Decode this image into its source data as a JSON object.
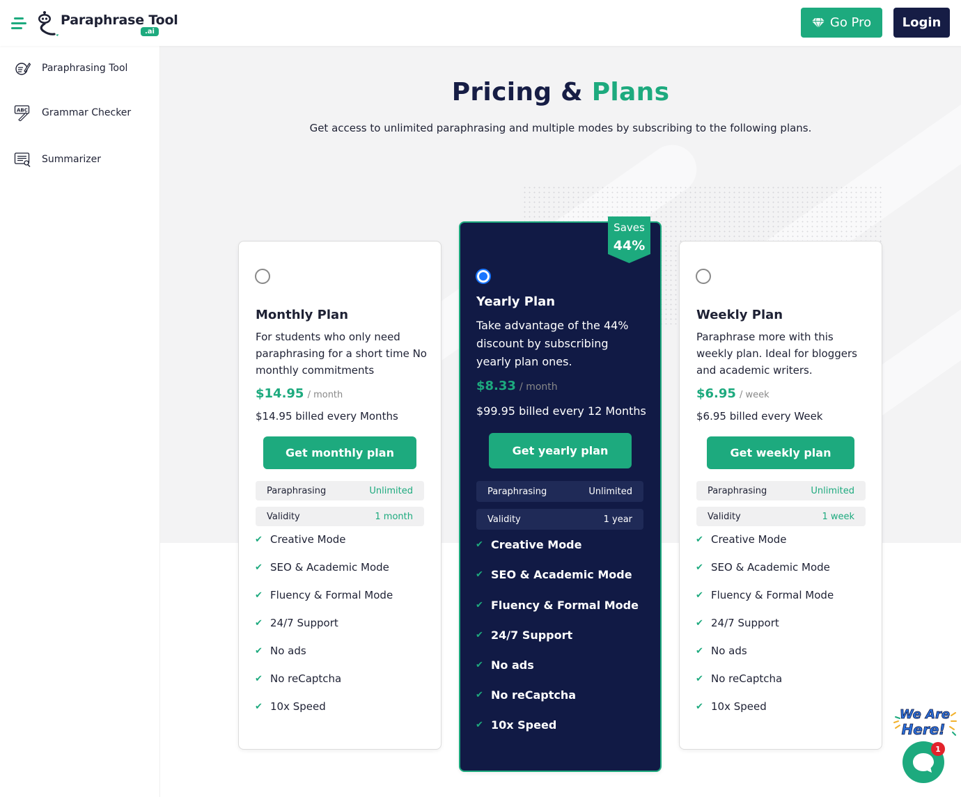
{
  "header": {
    "logo_text": "Paraphrase Tool",
    "logo_badge": ".ai",
    "go_pro_label": "Go Pro",
    "login_label": "Login"
  },
  "sidebar": {
    "items": [
      {
        "label": "Paraphrasing Tool",
        "icon": "paraphrase-icon"
      },
      {
        "label": "Grammar Checker",
        "icon": "grammar-icon"
      },
      {
        "label": "Summarizer",
        "icon": "summarizer-icon"
      }
    ]
  },
  "page": {
    "title_part1": "Pricing &",
    "title_part2": "Plans",
    "subtitle": "Get access to unlimited paraphrasing and multiple modes by subscribing to the following plans."
  },
  "plans": [
    {
      "name": "Monthly Plan",
      "selected": false,
      "description": "For students who only need paraphrasing for a short time No monthly commitments",
      "price": "$14.95",
      "period": "/ month",
      "billed": "$14.95 billed every Months",
      "cta": "Get monthly plan",
      "paraphrasing_label": "Paraphrasing",
      "paraphrasing_value": "Unlimited",
      "validity_label": "Validity",
      "validity_value": "1 month",
      "features": [
        "Creative Mode",
        "SEO & Academic Mode",
        "Fluency & Formal Mode",
        "24/7 Support",
        "No ads",
        "No reCaptcha",
        "10x Speed"
      ]
    },
    {
      "name": "Yearly Plan",
      "selected": true,
      "description": "Take advantage of the 44% discount by subscribing yearly plan ones.",
      "price": "$8.33",
      "period": "/ month",
      "billed": "$99.95 billed every 12 Months",
      "cta": "Get yearly plan",
      "paraphrasing_label": "Paraphrasing",
      "paraphrasing_value": "Unlimited",
      "validity_label": "Validity",
      "validity_value": "1 year",
      "saves_label": "Saves",
      "saves_value": "44%",
      "features": [
        "Creative Mode",
        "SEO & Academic Mode",
        "Fluency & Formal Mode",
        "24/7 Support",
        "No ads",
        "No reCaptcha",
        "10x Speed"
      ]
    },
    {
      "name": "Weekly Plan",
      "selected": false,
      "description": "Paraphrase more with this weekly plan. Ideal for bloggers and academic writers.",
      "price": "$6.95",
      "period": "/ week",
      "billed": "$6.95 billed every Week",
      "cta": "Get weekly plan",
      "paraphrasing_label": "Paraphrasing",
      "paraphrasing_value": "Unlimited",
      "validity_label": "Validity",
      "validity_value": "1 week",
      "features": [
        "Creative Mode",
        "SEO & Academic Mode",
        "Fluency & Formal Mode",
        "24/7 Support",
        "No ads",
        "No reCaptcha",
        "10x Speed"
      ]
    }
  ],
  "chat": {
    "banner_line1": "We Are",
    "banner_line2": "Here!",
    "unread_count": "1"
  },
  "colors": {
    "accent_green": "#1daa7e",
    "navy": "#161d45",
    "dark_card": "#111a45",
    "radio_blue": "#1976ff",
    "badge_red": "#e3232b"
  }
}
